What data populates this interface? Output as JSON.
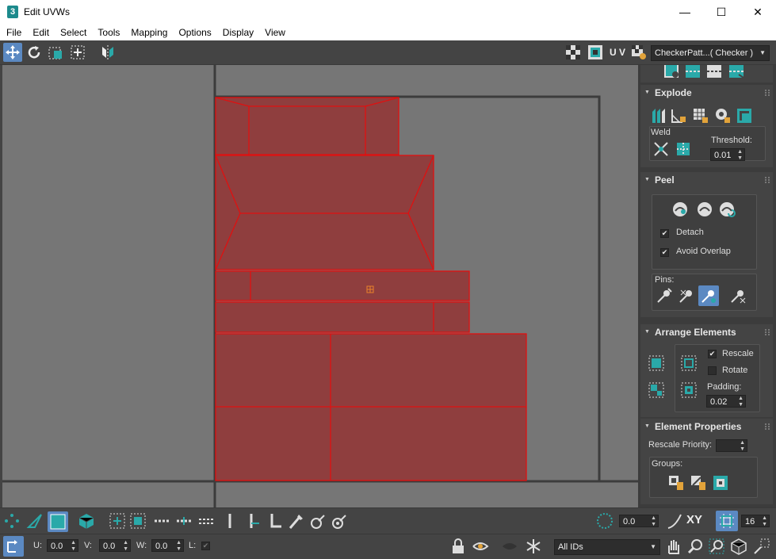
{
  "window": {
    "title": "Edit UVWs",
    "app_icon_text": "3",
    "minimize": "—",
    "maximize": "☐",
    "close": "✕"
  },
  "menu": [
    "File",
    "Edit",
    "Select",
    "Tools",
    "Mapping",
    "Options",
    "Display",
    "View"
  ],
  "toolbar": {
    "uv_label": "U V",
    "map_dropdown": "CheckerPatt...( Checker )"
  },
  "panel": {
    "explode": {
      "title": "Explode",
      "weld_label": "Weld",
      "threshold_label": "Threshold:",
      "threshold_value": "0.01"
    },
    "peel": {
      "title": "Peel",
      "detach_label": "Detach",
      "detach_checked": true,
      "avoid_overlap_label": "Avoid Overlap",
      "avoid_overlap_checked": true,
      "pins_label": "Pins:"
    },
    "arrange": {
      "title": "Arrange Elements",
      "rescale_label": "Rescale",
      "rescale_checked": true,
      "rotate_label": "Rotate",
      "rotate_checked": false,
      "padding_label": "Padding:",
      "padding_value": "0.02"
    },
    "element_props": {
      "title": "Element Properties",
      "rescale_priority_label": "Rescale Priority:",
      "rescale_priority_value": "",
      "groups_label": "Groups:"
    }
  },
  "bottom": {
    "rotation_value": "0.0",
    "xy_label": "XY",
    "grid_value": "16",
    "u_label": "U:",
    "u_value": "0.0",
    "v_label": "V:",
    "v_value": "0.0",
    "w_label": "W:",
    "w_value": "0.0",
    "l_label": "L:",
    "ids_dropdown": "All IDs"
  },
  "colors": {
    "accent": "#5b89c2",
    "uv_fill": "#8f3e3e",
    "uv_edge": "#e01010",
    "teal": "#2aa9a9",
    "viewport_bg": "#767676"
  }
}
